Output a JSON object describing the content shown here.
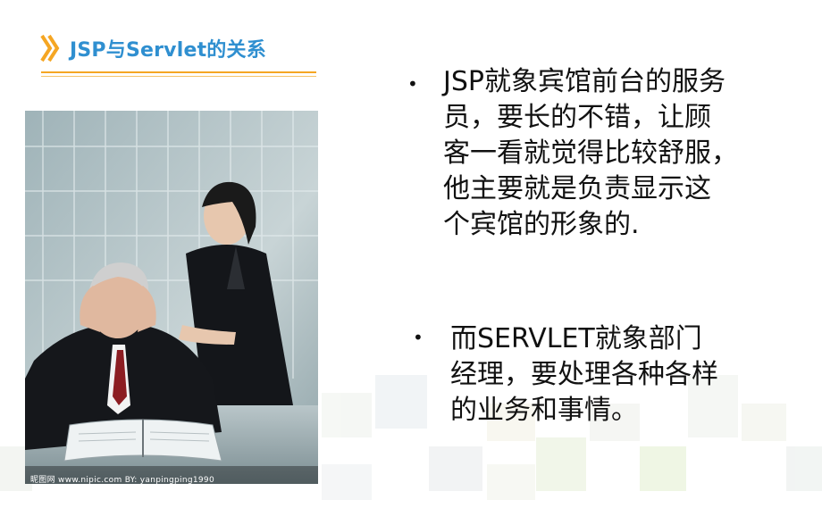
{
  "slide": {
    "title": "JSP与Servlet的关系",
    "bullets": [
      {
        "text": "JSP就象宾馆前台的服务\n员，要长的不错，让顾\n客一看就觉得比较舒服，\n他主要就是负责显示这\n个宾馆的形象的."
      },
      {
        "text": "而SERVLET就象部门\n经理，要处理各种各样\n的业务和事情。"
      }
    ],
    "image": {
      "alt": "Businessman holding head at desk with colleague consoling him",
      "watermark": "昵图网 www.nipic.com   BY: yanpingping1990"
    },
    "bullet_symbol": "•"
  },
  "colors": {
    "title": "#2f8fd0",
    "accent_orange": "#f5a623",
    "text": "#111111"
  },
  "icons": {
    "title_marker": "double-chevron-right-icon"
  }
}
